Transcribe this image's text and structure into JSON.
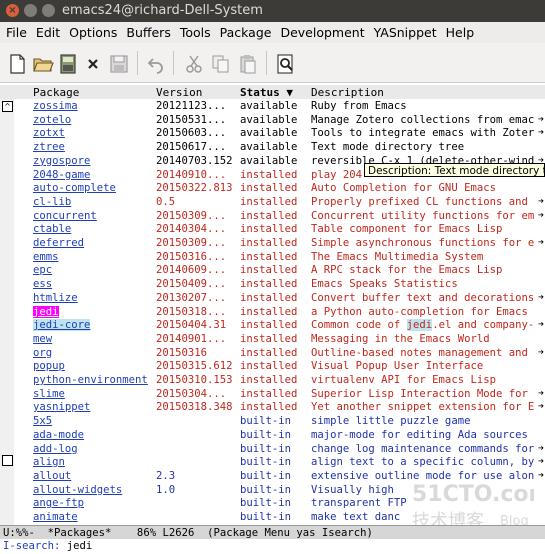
{
  "window": {
    "title": "emacs24@richard-Dell-System"
  },
  "menubar": [
    "File",
    "Edit",
    "Options",
    "Buffers",
    "Tools",
    "Package",
    "Development",
    "YASnippet",
    "Help"
  ],
  "toolbar": {
    "icons": [
      "new-file-icon",
      "open-folder-icon",
      "save-icon",
      "close-icon",
      "disk-icon",
      "undo-icon",
      "cut-icon",
      "copy-icon",
      "paste-icon",
      "search-icon"
    ]
  },
  "header": {
    "package": "Package",
    "version": "Version",
    "status": "Status ▼",
    "description": "Description"
  },
  "tooltip": "Description: Text mode directory t",
  "rows": [
    {
      "name": "zossima",
      "version": "20121123...",
      "status": "available",
      "desc": "Ruby from Emacs",
      "cls": "available",
      "arrow": ""
    },
    {
      "name": "zotelo",
      "version": "20150531...",
      "status": "available",
      "desc": "Manage Zotero collections from emac",
      "cls": "available",
      "arrow": "➔"
    },
    {
      "name": "zotxt",
      "version": "20150603...",
      "status": "available",
      "desc": "Tools to integrate emacs with Zoter",
      "cls": "available",
      "arrow": "➔"
    },
    {
      "name": "ztree",
      "version": "20150617...",
      "status": "available",
      "desc": "Text mode directory tree",
      "cls": "available",
      "arrow": ""
    },
    {
      "name": "zygospore",
      "version": "20140703.152",
      "status": "available",
      "desc": "reversible C-x 1 (delete-other-wind",
      "cls": "available",
      "arrow": "➔"
    },
    {
      "name": "2048-game",
      "version": "20140910...",
      "status": "installed",
      "desc": "play 204",
      "cls": "installed",
      "arrow": ""
    },
    {
      "name": "auto-complete",
      "version": "20150322.813",
      "status": "installed",
      "desc": "Auto Completion for GNU Emacs",
      "cls": "installed",
      "arrow": ""
    },
    {
      "name": "cl-lib",
      "version": "0.5",
      "status": "installed",
      "desc": "Properly prefixed CL functions and",
      "cls": "installed",
      "arrow": "➔"
    },
    {
      "name": "concurrent",
      "version": "20150309...",
      "status": "installed",
      "desc": "Concurrent utility functions for em",
      "cls": "installed",
      "arrow": "➔"
    },
    {
      "name": "ctable",
      "version": "20140304...",
      "status": "installed",
      "desc": "Table component for Emacs Lisp",
      "cls": "installed",
      "arrow": ""
    },
    {
      "name": "deferred",
      "version": "20150309...",
      "status": "installed",
      "desc": "Simple asynchronous functions for e",
      "cls": "installed",
      "arrow": "➔"
    },
    {
      "name": "emms",
      "version": "20150316...",
      "status": "installed",
      "desc": "The Emacs Multimedia System",
      "cls": "installed",
      "arrow": ""
    },
    {
      "name": "epc",
      "version": "20140609...",
      "status": "installed",
      "desc": "A RPC stack for the Emacs Lisp",
      "cls": "installed",
      "arrow": ""
    },
    {
      "name": "ess",
      "version": "20150409...",
      "status": "installed",
      "desc": "Emacs Speaks Statistics",
      "cls": "installed",
      "arrow": ""
    },
    {
      "name": "htmlize",
      "version": "20130207...",
      "status": "installed",
      "desc": "Convert buffer text and decorations",
      "cls": "installed",
      "arrow": "➔"
    },
    {
      "name": "jedi",
      "version": "20150318...",
      "status": "installed",
      "desc": "a Python auto-completion for Emacs",
      "cls": "installed",
      "arrow": ""
    },
    {
      "name": "jedi-core",
      "version": "20150404.31",
      "status": "installed",
      "desc": "Common code of jedi.el and company-",
      "cls": "installed",
      "arrow": "➔"
    },
    {
      "name": "mew",
      "version": "20140901...",
      "status": "installed",
      "desc": "Messaging in the Emacs World",
      "cls": "installed",
      "arrow": ""
    },
    {
      "name": "org",
      "version": "20150316",
      "status": "installed",
      "desc": "Outline-based notes management and",
      "cls": "installed",
      "arrow": "➔"
    },
    {
      "name": "popup",
      "version": "20150315.612",
      "status": "installed",
      "desc": "Visual Popup User Interface",
      "cls": "installed",
      "arrow": ""
    },
    {
      "name": "python-environment",
      "version": "20150310.153",
      "status": "installed",
      "desc": "virtualenv API for Emacs Lisp",
      "cls": "installed",
      "arrow": ""
    },
    {
      "name": "slime",
      "version": "20150304...",
      "status": "installed",
      "desc": "Superior Lisp Interaction Mode for",
      "cls": "installed",
      "arrow": "➔"
    },
    {
      "name": "yasnippet",
      "version": "20150318.348",
      "status": "installed",
      "desc": "Yet another snippet extension for E",
      "cls": "installed",
      "arrow": "➔"
    },
    {
      "name": "5x5",
      "version": "",
      "status": "built-in",
      "desc": "simple little puzzle game",
      "cls": "builtin",
      "arrow": ""
    },
    {
      "name": "ada-mode",
      "version": "",
      "status": "built-in",
      "desc": "major-mode for editing Ada sources",
      "cls": "builtin",
      "arrow": ""
    },
    {
      "name": "add-log",
      "version": "",
      "status": "built-in",
      "desc": "change log maintenance commands for",
      "cls": "builtin",
      "arrow": "➔"
    },
    {
      "name": "align",
      "version": "",
      "status": "built-in",
      "desc": "align text to a specific column, by",
      "cls": "builtin",
      "arrow": "➔"
    },
    {
      "name": "allout",
      "version": "2.3",
      "status": "built-in",
      "desc": "extensive outline mode for use alon",
      "cls": "builtin",
      "arrow": "➔"
    },
    {
      "name": "allout-widgets",
      "version": "1.0",
      "status": "built-in",
      "desc": "Visually high",
      "cls": "builtin",
      "arrow": ""
    },
    {
      "name": "ange-ftp",
      "version": "",
      "status": "built-in",
      "desc": "transparent FTP",
      "cls": "builtin",
      "arrow": ""
    },
    {
      "name": "animate",
      "version": "",
      "status": "built-in",
      "desc": "make text danc",
      "cls": "builtin",
      "arrow": ""
    }
  ],
  "modeline": "U:%%-  *Packages*    86% L2626  (Package Menu yas Isearch)",
  "minibuffer": {
    "prompt": "I-search:",
    "query": "jedi"
  },
  "watermark": {
    "top": "51CTO.com",
    "bottom": "技术博客",
    "blog": "Blog"
  },
  "colors": {
    "installed": "#c0281e",
    "builtin": "#2033a8",
    "link": "#1f3fb8",
    "match": "#ff00ff"
  }
}
